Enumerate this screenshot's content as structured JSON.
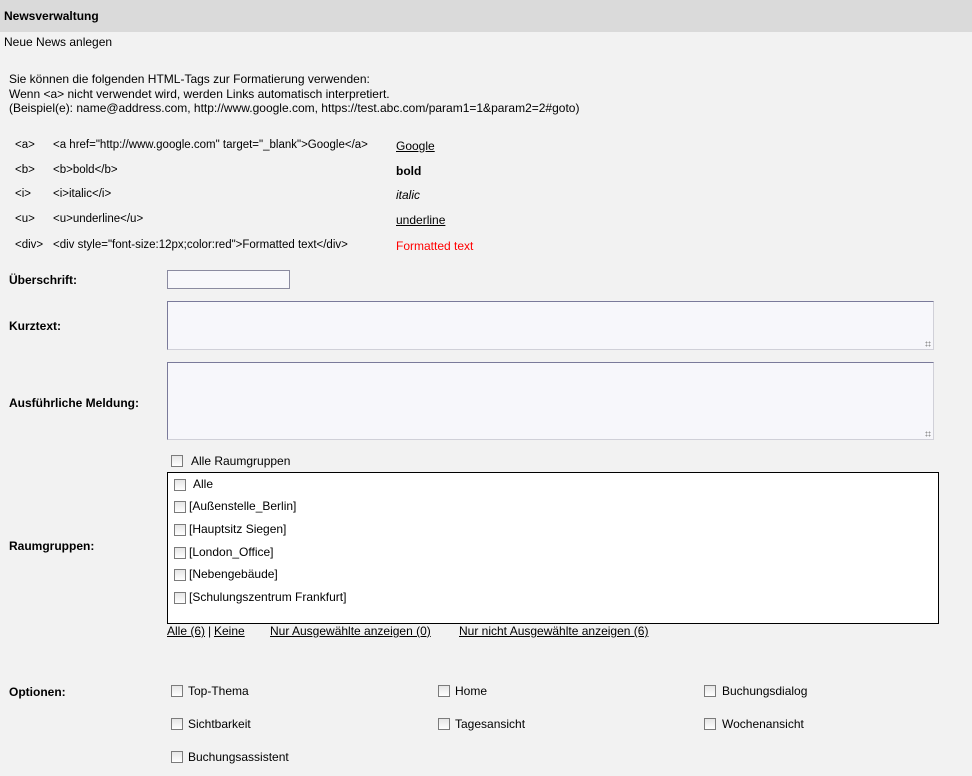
{
  "header": {
    "title": "Newsverwaltung"
  },
  "subtitle": "Neue News anlegen",
  "help": {
    "line1": "Sie können die folgenden HTML-Tags zur Formatierung verwenden:",
    "line2": "Wenn <a> nicht verwendet wird, werden Links automatisch interpretiert.",
    "line3": "(Beispiel(e): name@address.com, http://www.google.com, https://test.abc.com/param1=1&param2=2#goto)"
  },
  "tags": [
    {
      "tag": "<a>",
      "code": "<a href=\"http://www.google.com\" target=\"_blank\">Google</a>",
      "example": "Google"
    },
    {
      "tag": "<b>",
      "code": "<b>bold</b>",
      "example": "bold"
    },
    {
      "tag": "<i>",
      "code": "<i>italic</i>",
      "example": "italic"
    },
    {
      "tag": "<u>",
      "code": "<u>underline</u>",
      "example": "underline"
    },
    {
      "tag": "<div>",
      "code": "<div style=\"font-size:12px;color:red\">Formatted text</div>",
      "example": "Formatted text"
    }
  ],
  "form": {
    "ueberschrift_label": "Überschrift:",
    "ueberschrift_value": "",
    "kurztext_label": "Kurztext:",
    "kurztext_value": "",
    "meldung_label": "Ausführliche Meldung:",
    "meldung_value": "",
    "raumgruppen_label": "Raumgruppen:",
    "alle_raumgruppen": "Alle Raumgruppen",
    "raumgruppen_items": [
      "Alle",
      "[Außenstelle_Berlin]",
      "[Hauptsitz Siegen]",
      "[London_Office]",
      "[Nebengebäude]",
      "[Schulungszentrum Frankfurt]"
    ],
    "links": {
      "alle": "Alle (6)",
      "separator": "|",
      "keine": "Keine",
      "nur_ausgewaehlte": "Nur Ausgewählte anzeigen (0)",
      "nur_nicht_ausgewaehlte": "Nur nicht Ausgewählte anzeigen (6)"
    },
    "optionen_label": "Optionen:",
    "optionen": {
      "top_thema": "Top-Thema",
      "home": "Home",
      "buchungsdialog": "Buchungsdialog",
      "sichtbarkeit": "Sichtbarkeit",
      "tagesansicht": "Tagesansicht",
      "wochenansicht": "Wochenansicht",
      "buchungsassistent": "Buchungsassistent"
    }
  },
  "colors": {
    "formatted_text": "#ff0000",
    "header_bg": "#dadada",
    "page_bg": "#f2f2f2"
  }
}
